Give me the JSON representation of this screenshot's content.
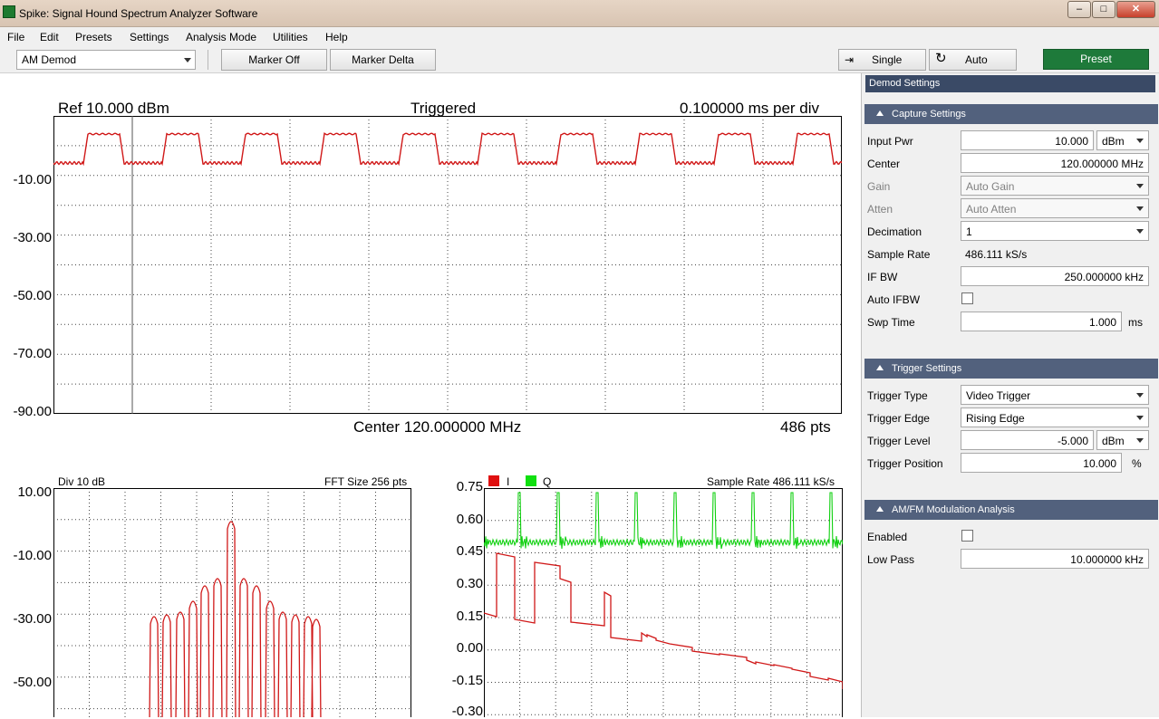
{
  "window": {
    "title": "Spike: Signal Hound Spectrum Analyzer Software",
    "min": "–",
    "max": "□",
    "close": "✕"
  },
  "menu": [
    "File",
    "Edit",
    "Presets",
    "Settings",
    "Analysis Mode",
    "Utilities",
    "Help"
  ],
  "toolbar": {
    "mode": "AM Demod",
    "marker_off": "Marker Off",
    "marker_delta": "Marker Delta",
    "single": "Single",
    "auto": "Auto",
    "preset": "Preset"
  },
  "main_plot": {
    "ref": "Ref 10.000 dBm",
    "status": "Triggered",
    "per_div": "0.100000 ms per div",
    "center": "Center 120.000000 MHz",
    "pts": "486 pts",
    "yticks": [
      "-10.00",
      "-30.00",
      "-50.00",
      "-70.00",
      "-90.00"
    ]
  },
  "fft_plot": {
    "div": "Div 10 dB",
    "fft_size": "FFT Size 256 pts",
    "yticks": [
      "10.00",
      "-10.00",
      "-30.00",
      "-50.00"
    ]
  },
  "iq_plot": {
    "i_label": "I",
    "q_label": "Q",
    "sample_rate": "Sample Rate 486.111 kS/s",
    "yticks": [
      "0.75",
      "0.60",
      "0.45",
      "0.30",
      "0.15",
      "0.00",
      "-0.15",
      "-0.30"
    ],
    "i_color": "#e01010",
    "q_color": "#10e010"
  },
  "panel": {
    "header": "Demod Settings",
    "capture": {
      "title": "Capture Settings",
      "input_pwr": "Input Pwr",
      "input_pwr_val": "10.000",
      "input_pwr_unit": "dBm",
      "center": "Center",
      "center_val": "120.000000 MHz",
      "gain": "Gain",
      "gain_val": "Auto Gain",
      "atten": "Atten",
      "atten_val": "Auto Atten",
      "decimation": "Decimation",
      "decimation_val": "1",
      "sample_rate": "Sample Rate",
      "sample_rate_val": "486.111 kS/s",
      "if_bw": "IF BW",
      "if_bw_val": "250.000000 kHz",
      "auto_ifbw": "Auto IFBW",
      "swp_time": "Swp Time",
      "swp_time_val": "1.000",
      "swp_time_unit": "ms"
    },
    "trigger": {
      "title": "Trigger Settings",
      "type": "Trigger Type",
      "type_val": "Video Trigger",
      "edge": "Trigger Edge",
      "edge_val": "Rising Edge",
      "level": "Trigger Level",
      "level_val": "-5.000",
      "level_unit": "dBm",
      "position": "Trigger Position",
      "position_val": "10.000",
      "position_unit": "%"
    },
    "amfm": {
      "title": "AM/FM Modulation Analysis",
      "enabled": "Enabled",
      "low_pass": "Low Pass",
      "low_pass_val": "10.000000 kHz"
    }
  }
}
